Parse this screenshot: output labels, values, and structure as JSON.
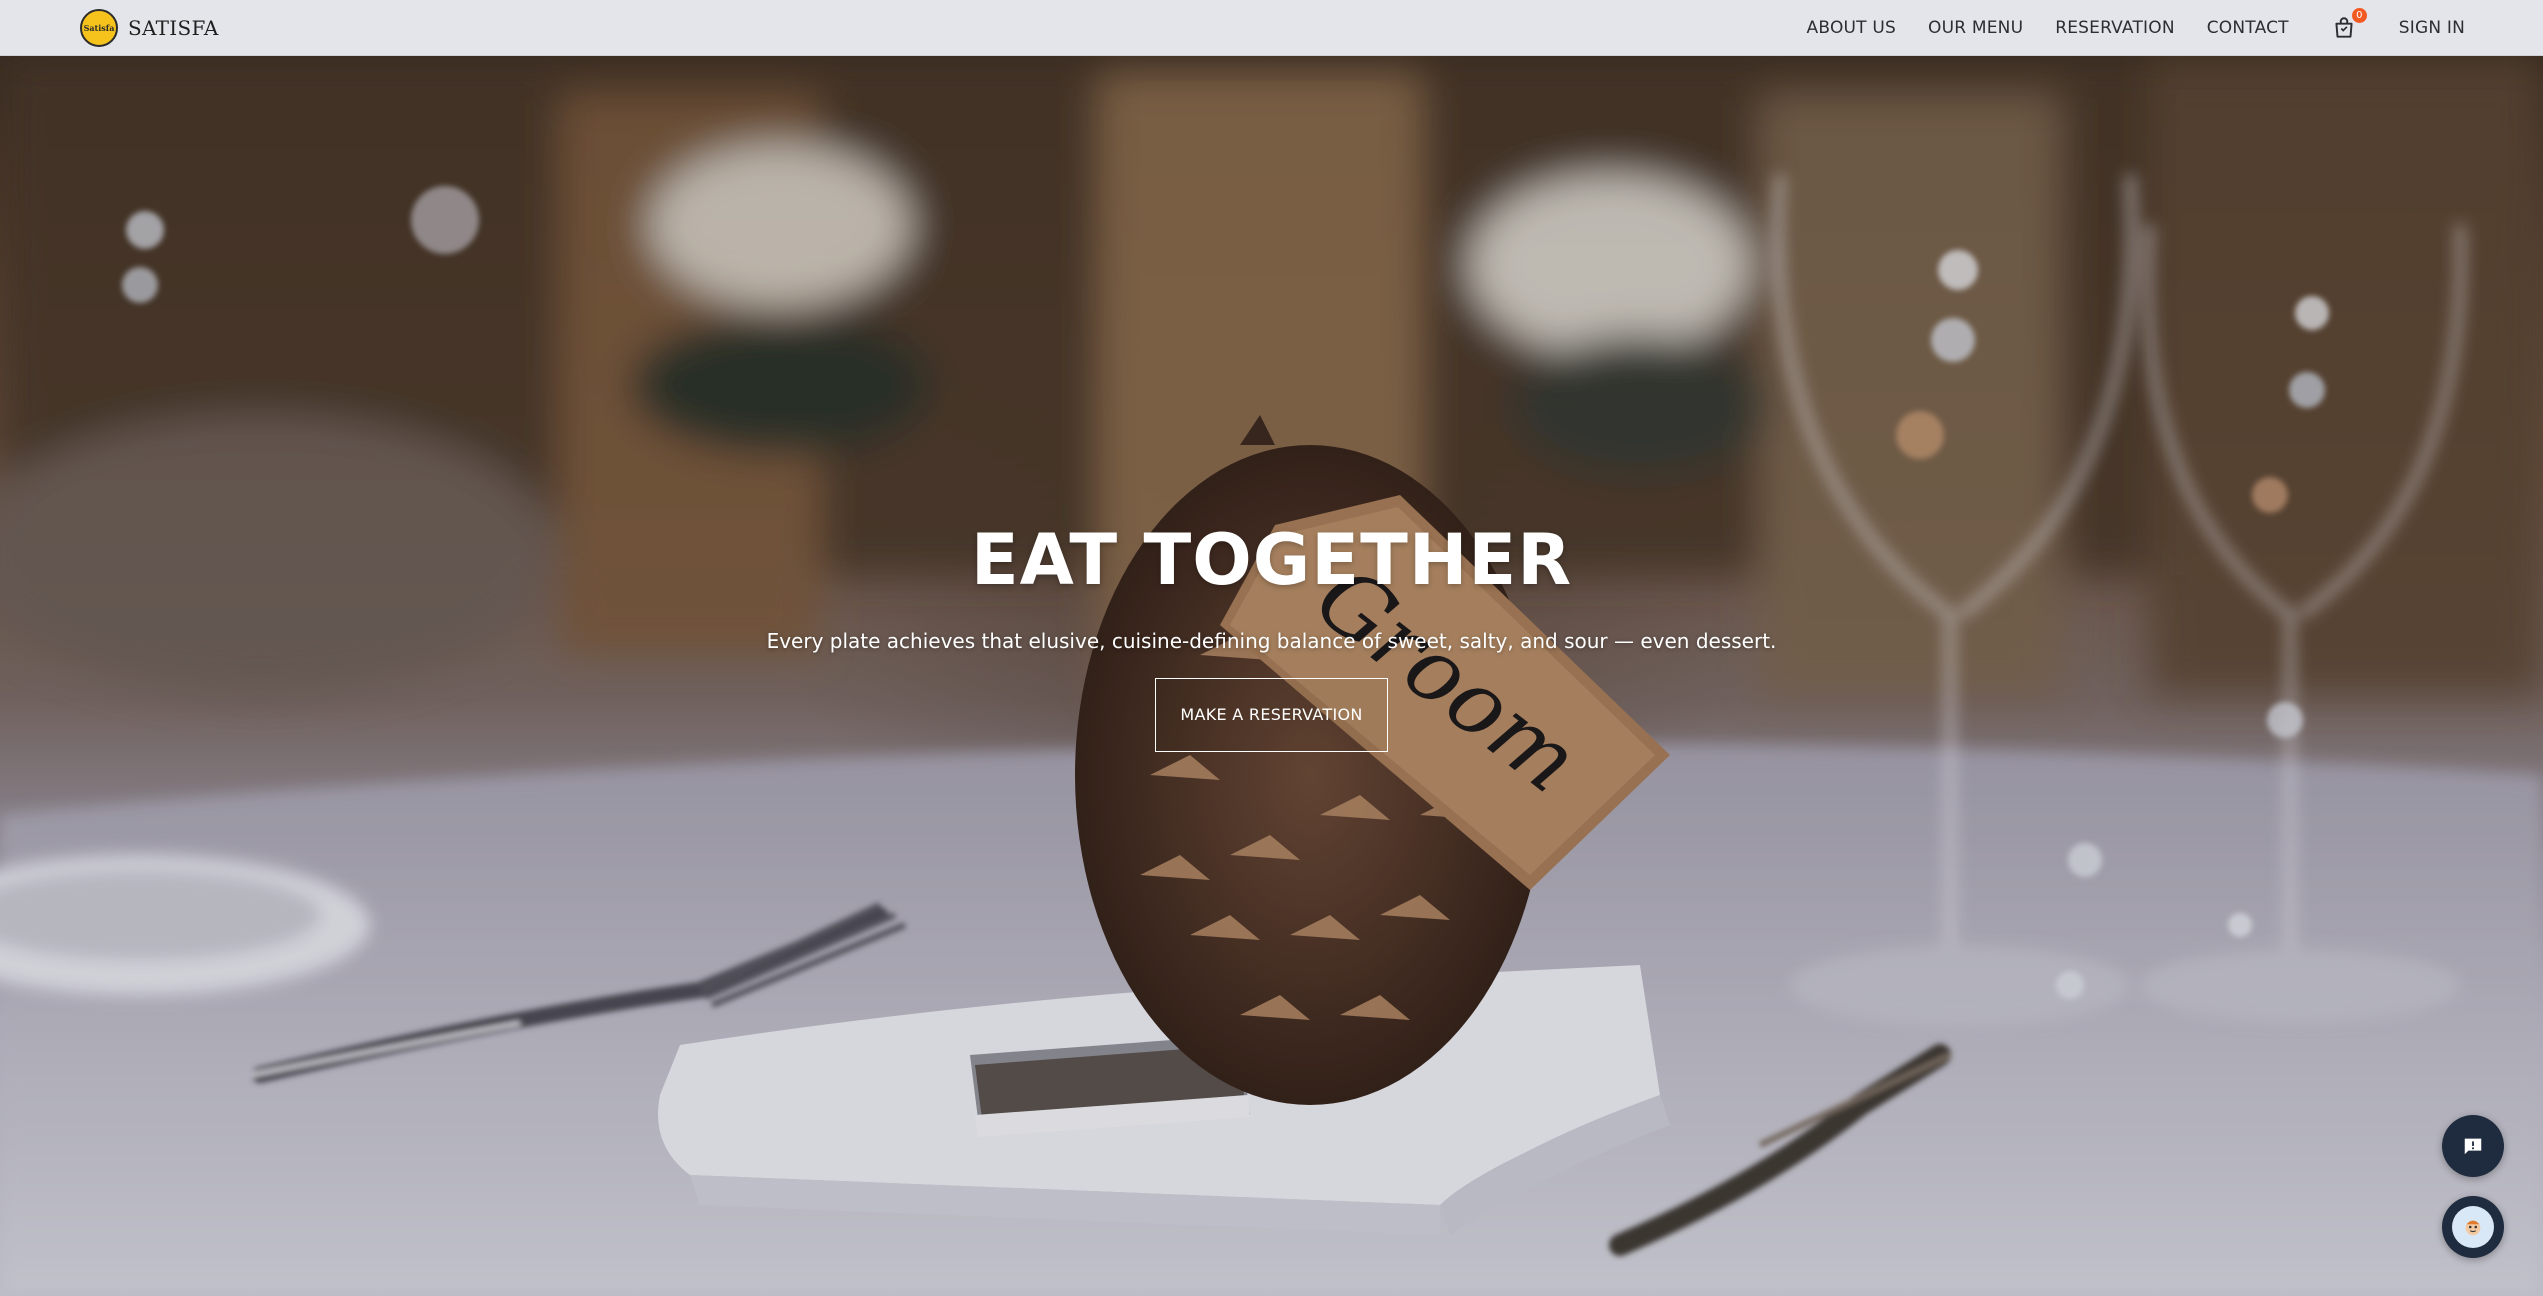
{
  "brand": {
    "logo_text": "Satisfa",
    "name": "SATISFA"
  },
  "nav": {
    "items": [
      {
        "label": "ABOUT US"
      },
      {
        "label": "OUR MENU"
      },
      {
        "label": "RESERVATION"
      },
      {
        "label": "CONTACT"
      }
    ],
    "cart_count": "0",
    "sign_in": "SIGN IN"
  },
  "hero": {
    "title": "EAT TOGETHER",
    "subtitle": "Every plate achieves that elusive, cuisine-defining balance of sweet, salty, and sour — even dessert.",
    "cta": "MAKE A RESERVATION",
    "tag_text": "Groom"
  },
  "icons": {
    "cart": "shopping-bag-icon",
    "feedback": "feedback-icon",
    "chat": "chat-bot-icon"
  },
  "colors": {
    "navbar_bg": "#e4e5ea",
    "logo_yellow": "#f6c21c",
    "badge": "#f25a22",
    "fab_bg": "#1f2b3e"
  }
}
